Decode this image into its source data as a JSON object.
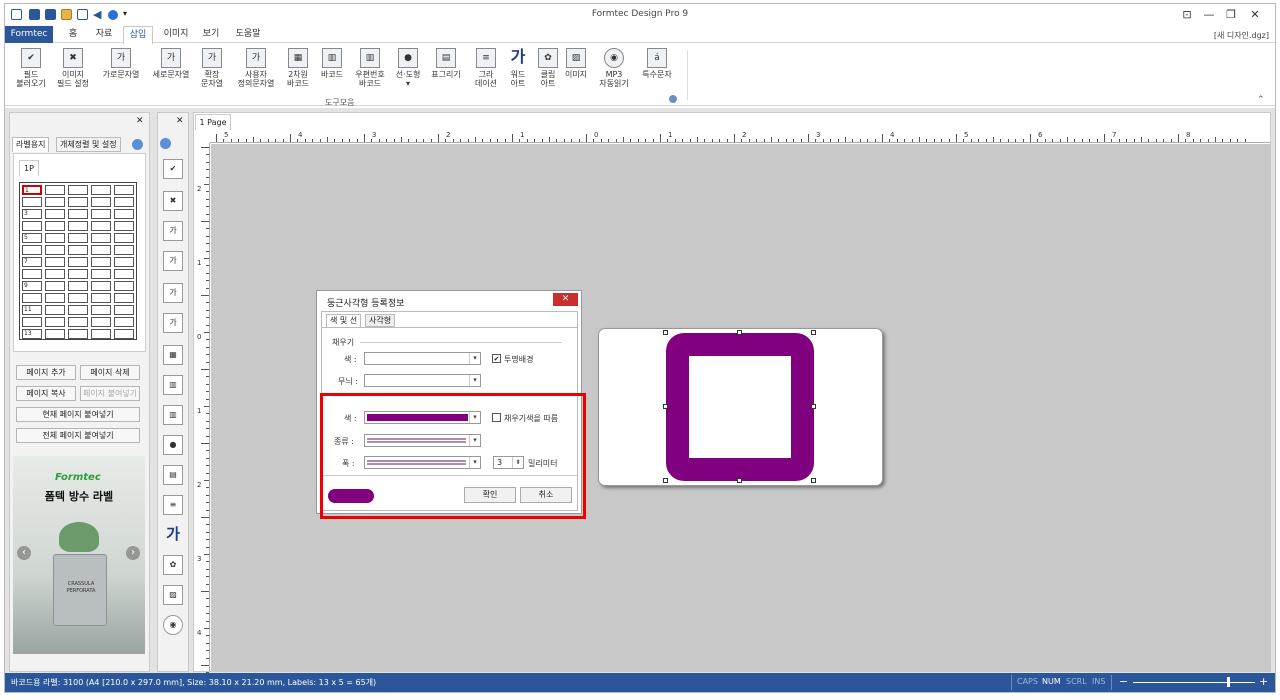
{
  "app": {
    "title": "Formtec Design Pro 9",
    "file": "[새 디자인.dgz]"
  },
  "tabs": [
    "Formtec",
    "홈",
    "자료",
    "삽입",
    "이미지",
    "보기",
    "도움말"
  ],
  "ribbon": {
    "buttons": [
      {
        "label": "필드\n불러오기",
        "icon": "checkbox-icon"
      },
      {
        "label": "이미지\n필드 설정",
        "icon": "image-field-icon"
      },
      {
        "label": "가로문자열",
        "icon": "horizontal-text-icon"
      },
      {
        "label": "세로문자열",
        "icon": "vertical-text-icon"
      },
      {
        "label": "확장\n문자열",
        "icon": "extended-text-icon"
      },
      {
        "label": "사용자\n정의문자열",
        "icon": "custom-text-icon"
      },
      {
        "label": "2차원\n바코드",
        "icon": "qr-code-icon"
      },
      {
        "label": "바코드",
        "icon": "barcode-icon"
      },
      {
        "label": "우편번호\n바코드",
        "icon": "postal-barcode-icon"
      },
      {
        "label": "선·도형\n▾",
        "icon": "shapes-icon"
      },
      {
        "label": "표그리기",
        "icon": "table-icon"
      },
      {
        "label": "그라\n데이션",
        "icon": "gradation-icon"
      },
      {
        "label": "워드\n아트",
        "icon": "wordart-icon"
      },
      {
        "label": "클립\n아트",
        "icon": "clipart-icon"
      },
      {
        "label": "이미지",
        "icon": "picture-icon"
      },
      {
        "label": "MP3\n자동읽기",
        "icon": "cd-icon"
      },
      {
        "label": "특수문자",
        "icon": "special-char-icon"
      }
    ],
    "group": "도구모음"
  },
  "left_panel": {
    "tabs": [
      "라벨용지",
      "개체정렬 및 설정"
    ],
    "page_tab": "1P",
    "row_numbers": [
      "1",
      "3",
      "5",
      "7",
      "9",
      "11",
      "13"
    ],
    "buttons": [
      "페이지 추가",
      "페이지 삭제",
      "페이지 복사",
      "페이지 붙여넣기",
      "현재 페이지 붙여넣기",
      "전체 페이지 붙여넣기"
    ],
    "ad": {
      "logo": "Formtec",
      "title": "폼텍 방수 라벨",
      "pot_line1": "CRASSULA",
      "pot_line2": "PERFORATA",
      "prev": "‹",
      "next": "›"
    }
  },
  "canvas": {
    "page_tab": "1 Page",
    "h_ruler": [
      "5",
      "4",
      "3",
      "2",
      "1",
      "0",
      "1",
      "2",
      "3",
      "4",
      "5",
      "6",
      "7",
      "8"
    ],
    "v_ruler": [
      "2",
      "1",
      "0",
      "1",
      "2",
      "3",
      "4"
    ]
  },
  "dialog": {
    "title": "둥근사각형 등록정보",
    "close": "✕",
    "tabs": [
      "색 및 선",
      "사각형"
    ],
    "fill_section": "채우기",
    "color_label": "색 :",
    "transparent": "투명배경",
    "pattern_label": "무늬 :",
    "line_color_label": "색 :",
    "follow_fill": "채우기색을 따름",
    "type_label": "종류 :",
    "width_label": "폭 :",
    "width_value": "3",
    "unit": "밀리미터",
    "ok": "확인",
    "cancel": "취소",
    "line_color": "#800080"
  },
  "shape": {
    "stroke": "#800080"
  },
  "status": {
    "text": "바코드용 라벨: 3100 (A4 [210.0 x 297.0 mm], Size: 38.10 x 21.20 mm,  Labels: 13 x 5 = 65개)",
    "caps": "CAPS",
    "num": "NUM",
    "scrl": "SCRL",
    "ins": "INS",
    "zoom_minus": "−",
    "zoom_plus": "+"
  }
}
